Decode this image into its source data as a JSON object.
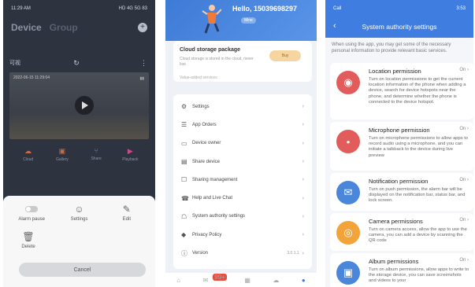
{
  "phone1": {
    "status_time": "11:29 AM",
    "status_icons": "HD 4G 5G 83",
    "tabs": [
      "Device",
      "Group"
    ],
    "device_name": "可视",
    "video_timestamp": "2022-06-15 11:29:04",
    "actions": [
      "Cloud",
      "Gallery",
      "Share",
      "Playback"
    ],
    "sheet_options": [
      "Alarm pause",
      "Settings",
      "Edit"
    ],
    "delete_label": "Delete",
    "cancel_label": "Cancel"
  },
  "phone2": {
    "username": "Hello, 15039698297",
    "user_badge": "Mine",
    "cloud_title": "Cloud storage package",
    "cloud_desc": "Cloud storage is stored in the cloud, never lost",
    "cloud_button": "Buy",
    "sub_note": "Value-added services",
    "menu": [
      {
        "icon": "gear-icon",
        "label": "Settings",
        "value": ""
      },
      {
        "icon": "order-icon",
        "label": "App Orders",
        "value": ""
      },
      {
        "icon": "device-icon",
        "label": "Device owner",
        "value": ""
      },
      {
        "icon": "share-icon",
        "label": "Share device",
        "value": ""
      },
      {
        "icon": "smart-icon",
        "label": "Sharing management",
        "value": ""
      },
      {
        "icon": "help-icon",
        "label": "Help and Live Chat",
        "value": ""
      },
      {
        "icon": "lock-icon",
        "label": "System authority settings",
        "value": ""
      },
      {
        "icon": "shield-icon",
        "label": "Privacy Policy",
        "value": ""
      },
      {
        "icon": "info-icon",
        "label": "Version",
        "value": "3.0.1.1"
      }
    ],
    "nav_badge": "99+"
  },
  "phone3": {
    "status_left": "Call",
    "status_right": "3:53",
    "title": "System authority settings",
    "intro": "When using the app, you may get some of the necessary personal information to provide relevant basic services.",
    "permissions": [
      {
        "name": "Location permission",
        "status": "On",
        "color": "#e25c5c",
        "glyph": "◉",
        "desc": "Turn on location permissions to get the current location information of the phone when adding a device, search for device hotspots near the phone, and determine whether the phone is connected to the device hotspot."
      },
      {
        "name": "Microphone permission",
        "status": "On",
        "color": "#e25c5c",
        "glyph": "•",
        "desc": "Turn on microphone permissions to allow apps to record audio using a microphone, and you can initiate a talkback to the device during live preview"
      },
      {
        "name": "Notification permission",
        "status": "On",
        "color": "#4a86d9",
        "glyph": "✉",
        "desc": "Turn on push permission, the alarm bar will be displayed on the notification bar, status bar, and lock screen."
      },
      {
        "name": "Camera permissions",
        "status": "On",
        "color": "#f2a43a",
        "glyph": "◎",
        "desc": "Turn on camera access, allow the app to use the camera, you can add a device by scanning the QR code"
      },
      {
        "name": "Album permissions",
        "status": "On",
        "color": "#4a86d9",
        "glyph": "▣",
        "desc": "Turn on album permissions, allow apps to write to the storage device, you can save screenshots and videos to your"
      }
    ]
  }
}
